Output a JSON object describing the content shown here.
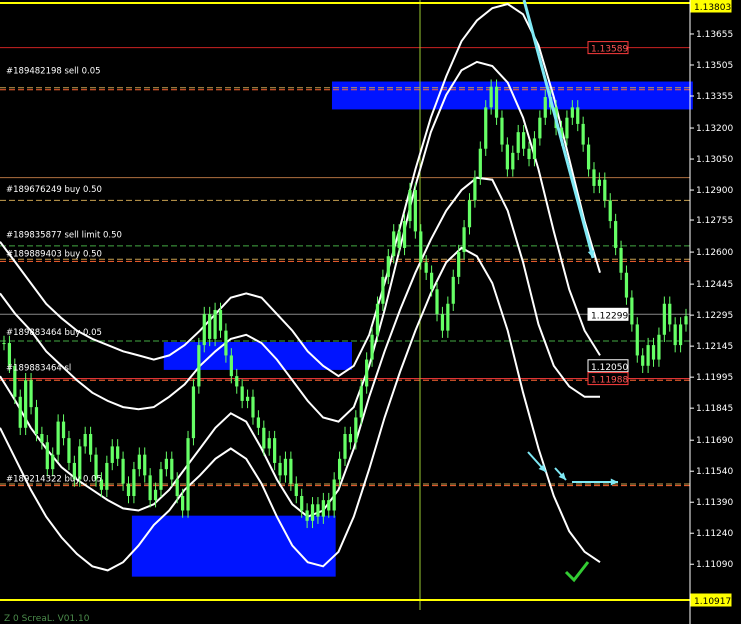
{
  "chart_data": {
    "type": "candlestick",
    "title": "",
    "subtitle": "",
    "footer": "Z 0 ScreaL. V01.10",
    "colors": {
      "background": "#000000",
      "candle": "#66ff66",
      "bands": "#ffffff",
      "zone": "#0014ff",
      "arrow": "#7fe9f5",
      "check": "#33cc33"
    },
    "yrange": [
      1.10917,
      1.138
    ],
    "y_ticks": [
      "1.13655",
      "1.13505",
      "1.13355",
      "1.13200",
      "1.13050",
      "1.12900",
      "1.12755",
      "1.12600",
      "1.12445",
      "1.12295",
      "1.12145",
      "1.11995",
      "1.11845",
      "1.11690",
      "1.11540",
      "1.11390",
      "1.11240",
      "1.11090"
    ],
    "price_tags": [
      {
        "text": "1.13589",
        "value": 1.13589,
        "color": "#ff3b3b",
        "text_color": "#ff5555",
        "fill": "#000000"
      },
      {
        "text": "1.12299",
        "value": 1.12299,
        "color": "#ffffff",
        "text_color": "#000000",
        "fill": "#ffffff"
      },
      {
        "text": "1.12050",
        "value": 1.1205,
        "color": "#ffffff",
        "text_color": "#ffffff",
        "fill": "#000000"
      },
      {
        "text": "1.11988",
        "value": 1.11988,
        "color": "#ff3b3b",
        "text_color": "#ff5555",
        "fill": "#000000"
      },
      {
        "text": "1.10917",
        "value": 1.10917,
        "color": "#ffff00",
        "text_color": "#000000",
        "fill": "#ffff00"
      },
      {
        "text": "1.13803",
        "value": 1.13803,
        "color": "#ffff00",
        "text_color": "#000000",
        "fill": "#ffff00"
      }
    ],
    "levels": [
      {
        "value": 1.13589,
        "color": "#cc2222",
        "style": "solid"
      },
      {
        "value": 1.13395,
        "color": "#c8a050",
        "style": "dash"
      },
      {
        "value": 1.13385,
        "color": "#ff6633",
        "style": "dash"
      },
      {
        "value": 1.1296,
        "color": "#b07040",
        "style": "solid"
      },
      {
        "value": 1.1285,
        "color": "#c8a050",
        "style": "dash"
      },
      {
        "value": 1.1263,
        "color": "#44aa44",
        "style": "dash"
      },
      {
        "value": 1.12565,
        "color": "#c8a050",
        "style": "dash"
      },
      {
        "value": 1.12555,
        "color": "#ff6633",
        "style": "dash"
      },
      {
        "value": 1.12299,
        "color": "#888888",
        "style": "solid"
      },
      {
        "value": 1.1217,
        "color": "#44aa44",
        "style": "dash"
      },
      {
        "value": 1.11988,
        "color": "#ff3b3b",
        "style": "solid"
      },
      {
        "value": 1.1198,
        "color": "#ff6633",
        "style": "dash"
      },
      {
        "value": 1.11478,
        "color": "#c8a050",
        "style": "dash"
      },
      {
        "value": 1.1147,
        "color": "#ff6633",
        "style": "dash"
      }
    ],
    "order_labels": [
      {
        "text": "#189482198 sell 0.05",
        "value": 1.13455,
        "color": "#ffffff"
      },
      {
        "text": "#189676249 buy 0.50",
        "value": 1.1288,
        "color": "#ffffff"
      },
      {
        "text": "#189835877 sell limit 0.50",
        "value": 1.1266,
        "color": "#ffffff"
      },
      {
        "text": "#189889403 buy 0.50",
        "value": 1.1257,
        "color": "#ffffff"
      },
      {
        "text": "#189883464 buy 0.05",
        "value": 1.1219,
        "color": "#ffffff"
      },
      {
        "text": "#189883464 sl",
        "value": 1.12018,
        "color": "#ffffff"
      },
      {
        "text": "#189214322 buy 0.05",
        "value": 1.1148,
        "color": "#ffffff"
      }
    ],
    "zones": [
      {
        "x0": 0.448,
        "x1": 0.935,
        "top": 1.13425,
        "bottom": 1.1329
      },
      {
        "x0": 0.221,
        "x1": 0.475,
        "top": 1.12165,
        "bottom": 1.1203
      },
      {
        "x0": 0.178,
        "x1": 0.453,
        "top": 1.11325,
        "bottom": 1.1103
      }
    ],
    "x_count": 150,
    "close": [
      1.1216,
      1.1205,
      1.119,
      1.1175,
      1.1198,
      1.1185,
      1.1172,
      1.1168,
      1.1155,
      1.1162,
      1.1178,
      1.117,
      1.1158,
      1.115,
      1.1166,
      1.1172,
      1.1162,
      1.115,
      1.1145,
      1.1158,
      1.1166,
      1.116,
      1.1148,
      1.1142,
      1.1155,
      1.1162,
      1.1152,
      1.114,
      1.1145,
      1.1155,
      1.116,
      1.115,
      1.1142,
      1.1135,
      1.117,
      1.1195,
      1.1215,
      1.123,
      1.1218,
      1.1232,
      1.1222,
      1.121,
      1.12,
      1.1195,
      1.1188,
      1.119,
      1.118,
      1.1175,
      1.1165,
      1.117,
      1.1158,
      1.1152,
      1.116,
      1.1148,
      1.1142,
      1.1135,
      1.113,
      1.1138,
      1.1132,
      1.114,
      1.1135,
      1.115,
      1.116,
      1.1172,
      1.1168,
      1.118,
      1.1195,
      1.1208,
      1.122,
      1.1235,
      1.1248,
      1.1258,
      1.127,
      1.1262,
      1.1275,
      1.129,
      1.127,
      1.1255,
      1.125,
      1.1242,
      1.123,
      1.1222,
      1.1235,
      1.1248,
      1.126,
      1.1272,
      1.1285,
      1.1296,
      1.131,
      1.133,
      1.134,
      1.1325,
      1.1312,
      1.13,
      1.1308,
      1.1318,
      1.131,
      1.1305,
      1.1315,
      1.1325,
      1.1335,
      1.133,
      1.132,
      1.1315,
      1.1325,
      1.133,
      1.1322,
      1.1312,
      1.13,
      1.1292,
      1.1295,
      1.1285,
      1.1275,
      1.1262,
      1.125,
      1.1238,
      1.1225,
      1.121,
      1.1205,
      1.1215,
      1.1208,
      1.122,
      1.1235,
      1.1225,
      1.1215,
      1.1225,
      1.1229
    ],
    "bands": {
      "outer_upper": [
        1.1265,
        1.1255,
        1.1245,
        1.1235,
        1.1228,
        1.1222,
        1.1218,
        1.1215,
        1.1212,
        1.121,
        1.1208,
        1.121,
        1.1215,
        1.1222,
        1.123,
        1.1238,
        1.124,
        1.1238,
        1.123,
        1.1222,
        1.1212,
        1.1205,
        1.12,
        1.1205,
        1.122,
        1.1245,
        1.1272,
        1.13,
        1.1325,
        1.1345,
        1.1362,
        1.1372,
        1.1378,
        1.138,
        1.1375,
        1.136,
        1.1335,
        1.1305,
        1.1275,
        1.125
      ],
      "inner_upper": [
        1.124,
        1.123,
        1.1222,
        1.1212,
        1.1205,
        1.1198,
        1.1192,
        1.1188,
        1.1185,
        1.1184,
        1.1185,
        1.119,
        1.1196,
        1.1205,
        1.1212,
        1.1218,
        1.122,
        1.1216,
        1.1208,
        1.1198,
        1.1188,
        1.118,
        1.1178,
        1.1185,
        1.1205,
        1.1232,
        1.1262,
        1.1292,
        1.1318,
        1.1336,
        1.1348,
        1.1352,
        1.135,
        1.1342,
        1.1325,
        1.13,
        1.127,
        1.1242,
        1.1222,
        1.121
      ],
      "inner_lower": [
        1.12,
        1.1188,
        1.1175,
        1.1165,
        1.1156,
        1.115,
        1.1145,
        1.114,
        1.1136,
        1.1135,
        1.1138,
        1.1145,
        1.1155,
        1.1165,
        1.1175,
        1.1182,
        1.1178,
        1.1165,
        1.115,
        1.1138,
        1.1132,
        1.1135,
        1.1145,
        1.1165,
        1.119,
        1.1212,
        1.1232,
        1.125,
        1.1266,
        1.128,
        1.129,
        1.1296,
        1.1295,
        1.128,
        1.1255,
        1.1225,
        1.1205,
        1.1195,
        1.119,
        1.119
      ],
      "outer_lower": [
        1.1175,
        1.116,
        1.1145,
        1.1132,
        1.1122,
        1.1114,
        1.1108,
        1.1106,
        1.111,
        1.1118,
        1.1128,
        1.1135,
        1.1145,
        1.1152,
        1.116,
        1.1165,
        1.116,
        1.1148,
        1.1132,
        1.1118,
        1.111,
        1.1108,
        1.1115,
        1.1132,
        1.1155,
        1.118,
        1.1202,
        1.1222,
        1.124,
        1.1255,
        1.1262,
        1.1258,
        1.1245,
        1.1222,
        1.1192,
        1.1165,
        1.1142,
        1.1125,
        1.1115,
        1.111
      ]
    }
  }
}
